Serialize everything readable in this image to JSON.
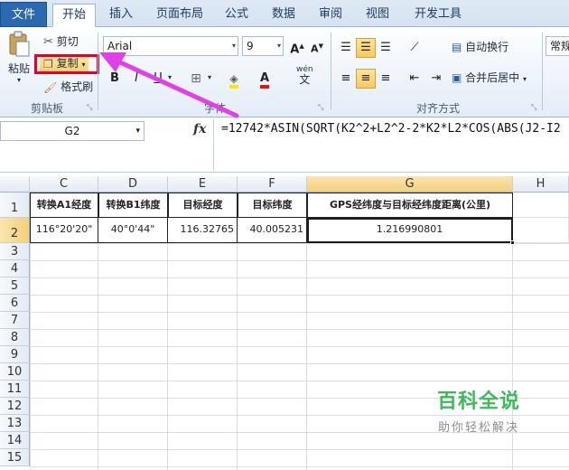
{
  "tabs": [
    "文件",
    "开始",
    "插入",
    "页面布局",
    "公式",
    "数据",
    "审阅",
    "视图",
    "开发工具"
  ],
  "clipboard": {
    "paste_label": "粘贴",
    "cut_label": "剪切",
    "copy_label": "复制",
    "format_painter_label": "格式刷",
    "group_label": "剪贴板"
  },
  "font": {
    "font_name": "Arial",
    "font_size": "9",
    "bold": "B",
    "italic": "I",
    "underline": "U",
    "grow": "A",
    "shrink": "A",
    "phonetic_top": "wén",
    "phonetic_bottom": "文",
    "group_label": "字体"
  },
  "alignment": {
    "wrap_text_label": "自动换行",
    "merge_center_label": "合并后居中",
    "group_label": "对齐方式"
  },
  "number": {
    "format_label": "常规"
  },
  "formula_bar": {
    "name_box": "G2",
    "fx": "fx",
    "formula": "=12742*ASIN(SQRT(K2^2+L2^2-2*K2*L2*COS(ABS(J2-I2"
  },
  "columns": [
    "C",
    "D",
    "E",
    "F",
    "G",
    "H"
  ],
  "rows": [
    "1",
    "2",
    "3",
    "4",
    "5",
    "6",
    "7",
    "8",
    "9",
    "10",
    "11",
    "12",
    "13",
    "14",
    "15"
  ],
  "table": {
    "headers": [
      "转换A1经度",
      "转换B1纬度",
      "目标经度",
      "目标纬度",
      "GPS经纬度与目标经纬度距离(公里)"
    ],
    "row2": [
      "116°20'20\"",
      "40°0'44\"",
      "116.32765",
      "40.005231",
      "1.216990801"
    ]
  },
  "watermark": {
    "title": "百科全说",
    "subtitle": "助你轻松解决"
  },
  "colors": {
    "highlight_box": "#e4002b",
    "arrow": "#e040e8",
    "file_tab": "#2b6ab0",
    "watermark_green": "#3dba5b"
  }
}
